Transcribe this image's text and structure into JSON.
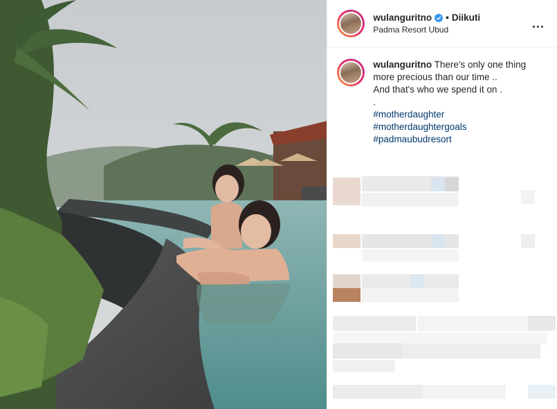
{
  "header": {
    "username": "wulanguritno",
    "verified_icon": "verified-badge-icon",
    "separator": "•",
    "follow_status": "Diikuti",
    "location": "Padma Resort Ubud",
    "more_label": "..."
  },
  "caption": {
    "username": "wulanguritno",
    "lines": [
      "There's only one thing more precious than our time ..",
      "And that's who we spend it on ."
    ],
    "dot": ".",
    "hashtags": [
      "#motherdaughter",
      "#motherdaughtergoals",
      "#padmaubudresort"
    ]
  },
  "colors": {
    "verified": "#3897f0",
    "hashtag": "#00376b",
    "border": "#efefef"
  }
}
